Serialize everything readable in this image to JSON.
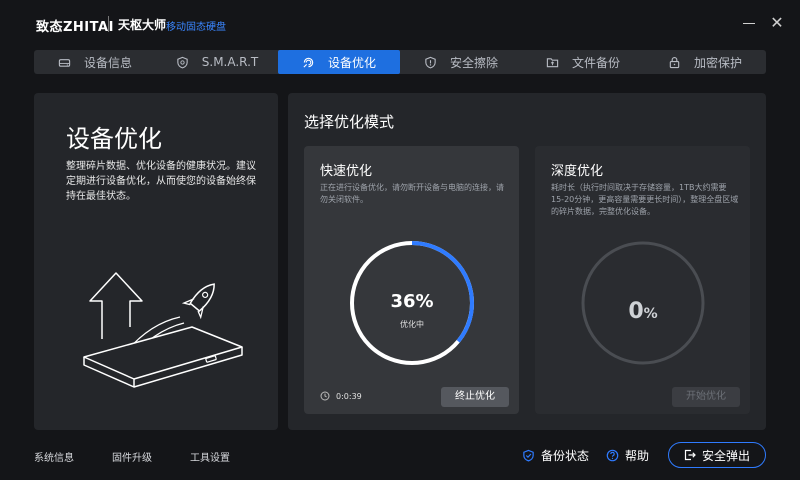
{
  "titlebar": {
    "brand": "致态ZHITAI",
    "product": "天枢大师",
    "product_sub": "移动固态硬盘",
    "minimize_icon": "minimize-icon",
    "close_icon": "close-icon"
  },
  "tabs": [
    {
      "label": "设备信息",
      "icon": "drive-icon",
      "active": false
    },
    {
      "label": "S.M.A.R.T",
      "icon": "shield-icon",
      "active": false
    },
    {
      "label": "设备优化",
      "icon": "optimize-icon",
      "active": true
    },
    {
      "label": "安全擦除",
      "icon": "alert-shield-icon",
      "active": false
    },
    {
      "label": "文件备份",
      "icon": "folder-icon",
      "active": false
    },
    {
      "label": "加密保护",
      "icon": "lock-icon",
      "active": false
    }
  ],
  "left": {
    "title": "设备优化",
    "description": "整理碎片数据、优化设备的健康状况。建议定期进行设备优化，从而使您的设备始终保持在最佳状态。"
  },
  "right": {
    "title": "选择优化模式",
    "quick": {
      "title": "快速优化",
      "description": "正在进行设备优化，请勿断开设备与电脑的连接，请勿关闭软件。",
      "progress_label": "36%",
      "progress_value": 0.36,
      "status": "优化中",
      "elapsed": "0:0:39",
      "button": "终止优化"
    },
    "deep": {
      "title": "深度优化",
      "description": "耗时长（执行时间取决于存储容量，1TB大约需要15-20分钟，更高容量需要更长时间），整理全盘区域的碎片数据，完整优化设备。",
      "progress_number": "0",
      "progress_unit": "%",
      "progress_value": 0,
      "button": "开始优化"
    }
  },
  "footer": {
    "links": [
      "系统信息",
      "固件升级",
      "工具设置"
    ],
    "backup_status": "备份状态",
    "help": "帮助",
    "eject": "安全弹出"
  },
  "colors": {
    "accent": "#1e6fe0",
    "ring_track": "#ffffff",
    "ring_progress": "#2f7bff",
    "deep_ring": "#4a4d52"
  }
}
